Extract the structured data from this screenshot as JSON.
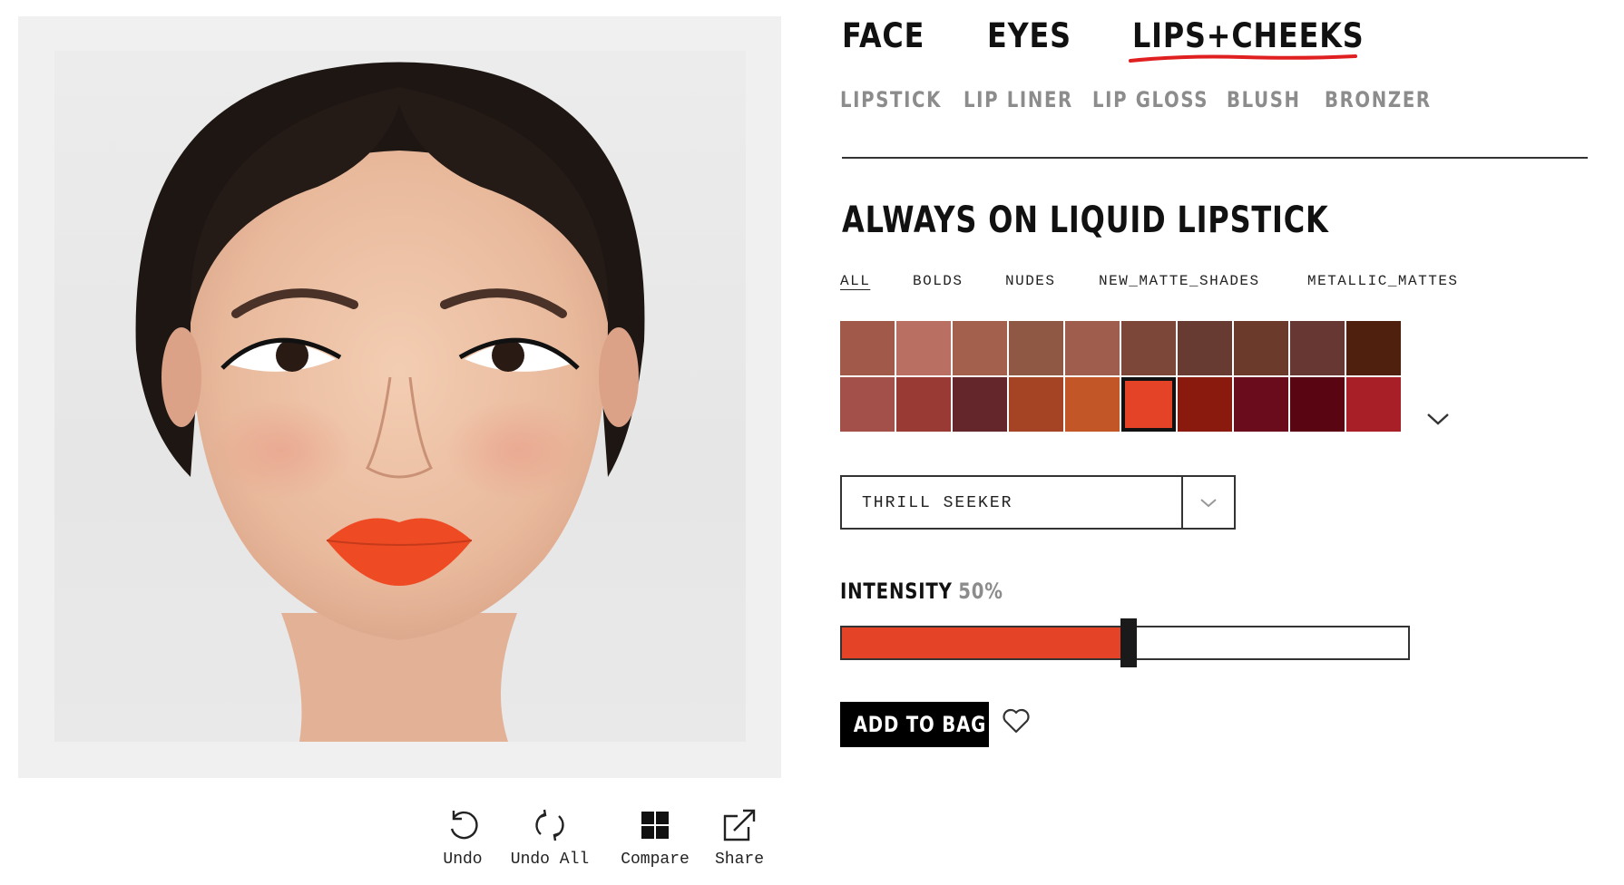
{
  "category_tabs": [
    {
      "label": "FACE",
      "active": false
    },
    {
      "label": "EYES",
      "active": false
    },
    {
      "label": "LIPS+CHEEKS",
      "active": true
    }
  ],
  "sub_tabs": [
    "LIPSTICK",
    "LIP LINER",
    "LIP GLOSS",
    "BLUSH",
    "BRONZER"
  ],
  "product": {
    "title": "ALWAYS ON LIQUID LIPSTICK"
  },
  "filters": [
    {
      "label": "ALL",
      "active": true
    },
    {
      "label": "BOLDS",
      "active": false
    },
    {
      "label": "NUDES",
      "active": false
    },
    {
      "label": "NEW_MATTE_SHADES",
      "active": false
    },
    {
      "label": "METALLIC_MATTES",
      "active": false
    }
  ],
  "swatches": [
    [
      "#a15a4a",
      "#b96f62",
      "#a3604d",
      "#8f5845",
      "#9e5d4d",
      "#7c4638",
      "#673a32",
      "#6b3a2a",
      "#673733",
      "#50200e"
    ],
    [
      "#a4504a",
      "#993a34",
      "#64262a",
      "#a54325",
      "#c25627",
      "#e44327",
      "#8a1a0e",
      "#6a0c1c",
      "#5a0512",
      "#a81f28"
    ]
  ],
  "selected_swatch": {
    "row": 1,
    "col": 5
  },
  "shade_select": {
    "value": "THRILL SEEKER"
  },
  "intensity": {
    "label": "INTENSITY",
    "value_text": "50%",
    "value": 0.5
  },
  "accent_color": "#e44327",
  "add_to_bag": "ADD TO BAG",
  "tools": [
    {
      "label": "Undo",
      "icon": "undo-icon"
    },
    {
      "label": "Undo All",
      "icon": "undo-all-icon"
    },
    {
      "label": "Compare",
      "icon": "compare-icon"
    },
    {
      "label": "Share",
      "icon": "share-icon"
    }
  ]
}
